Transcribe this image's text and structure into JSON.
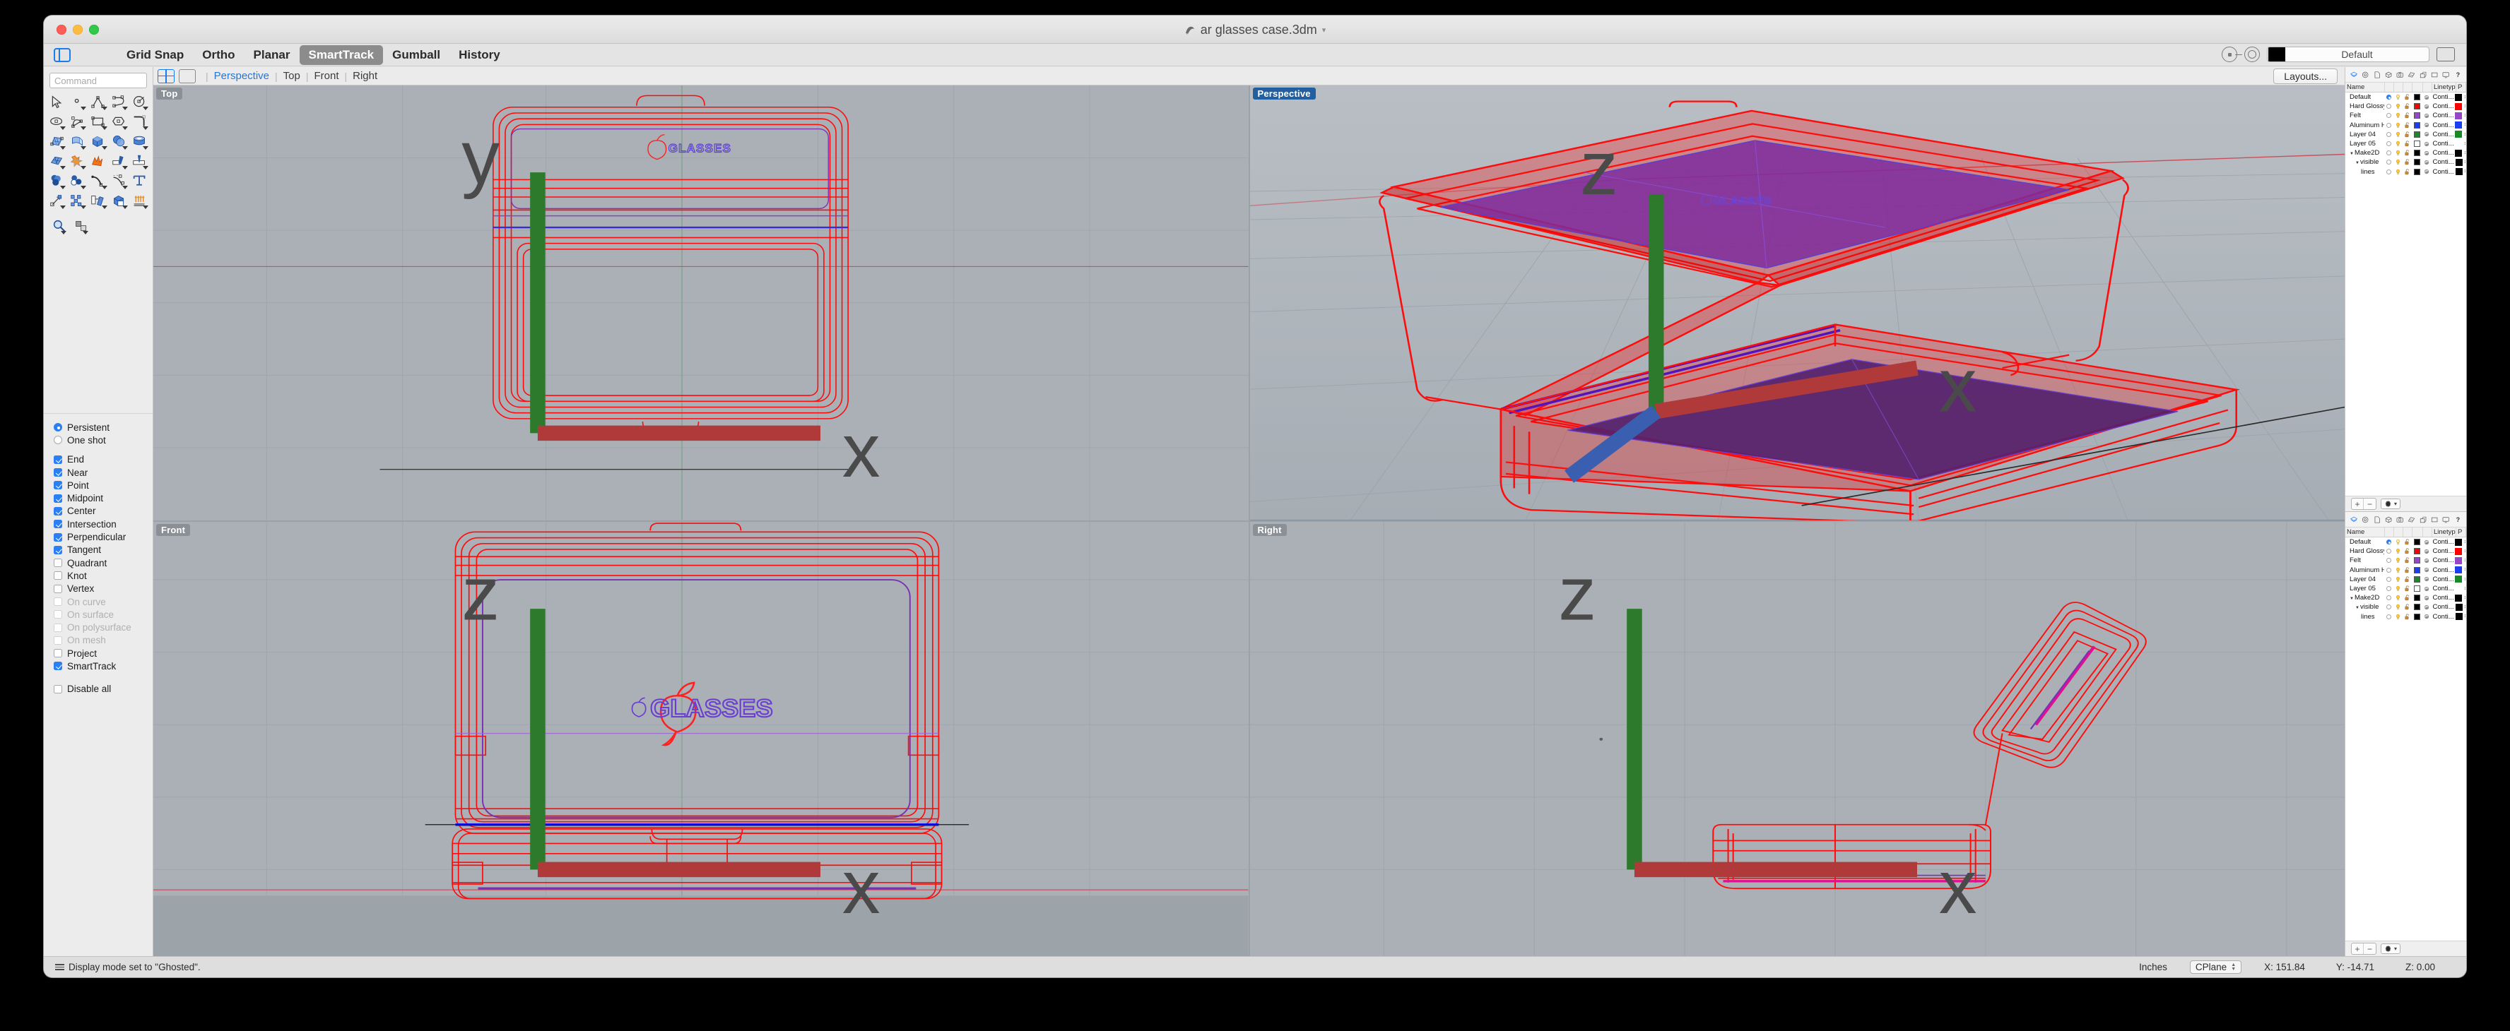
{
  "window": {
    "title": "ar glasses case.3dm",
    "doc_icon": "rhino-doc-icon",
    "title_chevron": "chevron-down-icon"
  },
  "toolbar": {
    "sidebar_toggle_icon": "sidebar-toggle-icon",
    "items": [
      {
        "label": "Grid Snap",
        "active": false
      },
      {
        "label": "Ortho",
        "active": false
      },
      {
        "label": "Planar",
        "active": false
      },
      {
        "label": "SmartTrack",
        "active": true
      },
      {
        "label": "Gumball",
        "active": false
      },
      {
        "label": "History",
        "active": false
      }
    ],
    "layer_color": "#000000",
    "layer_name": "Default",
    "osnap_icon": "osnap-icon",
    "record_icon": "record-history-icon",
    "panel_icon": "right-panel-icon"
  },
  "command": {
    "placeholder": "Command",
    "value": ""
  },
  "tools": [
    {
      "name": "select-arrow-tool",
      "icon": "arrow"
    },
    {
      "name": "point-tool",
      "icon": "point"
    },
    {
      "name": "polyline-tool",
      "icon": "polyline"
    },
    {
      "name": "curve-tool",
      "icon": "curve"
    },
    {
      "name": "circle-tool",
      "icon": "circle"
    },
    {
      "name": "ellipse-tool",
      "icon": "ellipse"
    },
    {
      "name": "arc-tool",
      "icon": "arc"
    },
    {
      "name": "rectangle-tool",
      "icon": "rectangle"
    },
    {
      "name": "polygon-tool",
      "icon": "polygon"
    },
    {
      "name": "fillet-curve-tool",
      "icon": "fillet"
    },
    {
      "name": "surface-from-points-tool",
      "icon": "srf-pts"
    },
    {
      "name": "sweep-surface-tool",
      "icon": "sweep"
    },
    {
      "name": "box-tool",
      "icon": "box"
    },
    {
      "name": "sphere-tool",
      "icon": "sphere"
    },
    {
      "name": "cylinder-tool",
      "icon": "cylinder"
    },
    {
      "name": "mesh-tool",
      "icon": "mesh"
    },
    {
      "name": "boolean-union-tool",
      "icon": "bool-union"
    },
    {
      "name": "explode-tool",
      "icon": "explode"
    },
    {
      "name": "trim-tool",
      "icon": "trim"
    },
    {
      "name": "split-tool",
      "icon": "split"
    },
    {
      "name": "boolean-tool",
      "icon": "bool-spheres"
    },
    {
      "name": "boolean-difference-tool",
      "icon": "bool-diff"
    },
    {
      "name": "offset-curve-tool",
      "icon": "offset-curve"
    },
    {
      "name": "dimension-tool",
      "icon": "dimension"
    },
    {
      "name": "text-tool",
      "icon": "text"
    },
    {
      "name": "scale-tool",
      "icon": "scale"
    },
    {
      "name": "array-tool",
      "icon": "array"
    },
    {
      "name": "copy-tool",
      "icon": "copy"
    },
    {
      "name": "cplane-tool",
      "icon": "cplane"
    },
    {
      "name": "extrude-tool",
      "icon": "extrude"
    }
  ],
  "bottom_tools": [
    {
      "name": "zoom-tool",
      "icon": "zoom"
    },
    {
      "name": "render-tool",
      "icon": "render"
    }
  ],
  "osnap": {
    "modes": [
      {
        "label": "Persistent",
        "type": "radio",
        "checked": true,
        "disabled": false
      },
      {
        "label": "One shot",
        "type": "radio",
        "checked": false,
        "disabled": false
      }
    ],
    "snaps": [
      {
        "label": "End",
        "checked": true,
        "disabled": false
      },
      {
        "label": "Near",
        "checked": true,
        "disabled": false
      },
      {
        "label": "Point",
        "checked": true,
        "disabled": false
      },
      {
        "label": "Midpoint",
        "checked": true,
        "disabled": false
      },
      {
        "label": "Center",
        "checked": true,
        "disabled": false
      },
      {
        "label": "Intersection",
        "checked": true,
        "disabled": false
      },
      {
        "label": "Perpendicular",
        "checked": true,
        "disabled": false
      },
      {
        "label": "Tangent",
        "checked": true,
        "disabled": false
      },
      {
        "label": "Quadrant",
        "checked": false,
        "disabled": false
      },
      {
        "label": "Knot",
        "checked": false,
        "disabled": false
      },
      {
        "label": "Vertex",
        "checked": false,
        "disabled": false
      },
      {
        "label": "On curve",
        "checked": false,
        "disabled": true
      },
      {
        "label": "On surface",
        "checked": false,
        "disabled": true
      },
      {
        "label": "On polysurface",
        "checked": false,
        "disabled": true
      },
      {
        "label": "On mesh",
        "checked": false,
        "disabled": true
      },
      {
        "label": "Project",
        "checked": false,
        "disabled": false
      },
      {
        "label": "SmartTrack",
        "checked": true,
        "disabled": false
      }
    ],
    "disable_all": {
      "label": "Disable all",
      "checked": false
    }
  },
  "viewport_bar": {
    "quad_icon": "four-viewport-icon",
    "single_icon": "single-viewport-icon",
    "tabs": [
      {
        "label": "Perspective",
        "active": true
      },
      {
        "label": "Top",
        "active": false
      },
      {
        "label": "Front",
        "active": false
      },
      {
        "label": "Right",
        "active": false
      }
    ],
    "layouts_label": "Layouts..."
  },
  "viewports": [
    {
      "label": "Top",
      "active": false
    },
    {
      "label": "Perspective",
      "active": true
    },
    {
      "label": "Front",
      "active": false
    },
    {
      "label": "Right",
      "active": false
    }
  ],
  "model": {
    "engraved_text": "GLASSES",
    "logo": "apple-logo",
    "shell_color": "#ff0000",
    "felt_color": "#7a2f9e",
    "hinge_color": "#1414ff"
  },
  "layers_panel": {
    "tab_icons": [
      "layers-icon",
      "properties-icon",
      "notes-icon",
      "object-icon",
      "render-icon",
      "materials-icon",
      "named-cplanes-icon",
      "named-views-icon",
      "display-icon",
      "help-icon"
    ],
    "columns": [
      "Name",
      "",
      "",
      "",
      "",
      "",
      "Linetype",
      "P"
    ],
    "rows": [
      {
        "name": "Default",
        "indent": 0,
        "current": true,
        "color": "#000000",
        "linetype": "Conti...",
        "print_color": "#000000",
        "expander": ""
      },
      {
        "name": "Hard Glossy P...",
        "indent": 0,
        "current": false,
        "color": "#ff0000",
        "linetype": "Conti...",
        "print_color": "#ff0000",
        "expander": ""
      },
      {
        "name": "Felt",
        "indent": 0,
        "current": false,
        "color": "#9448c8",
        "linetype": "Conti...",
        "print_color": "#9448c8",
        "expander": ""
      },
      {
        "name": "Aluminum Hin...",
        "indent": 0,
        "current": false,
        "color": "#1a3ef0",
        "linetype": "Conti...",
        "print_color": "#1a3ef0",
        "expander": ""
      },
      {
        "name": "Layer 04",
        "indent": 0,
        "current": false,
        "color": "#1a8a28",
        "linetype": "Conti...",
        "print_color": "#1a8a28",
        "expander": ""
      },
      {
        "name": "Layer 05",
        "indent": 0,
        "current": false,
        "color": "#ffffff",
        "linetype": "Conti...",
        "print_color": "#ffffff",
        "expander": ""
      },
      {
        "name": "Make2D",
        "indent": 0,
        "current": false,
        "color": "#000000",
        "linetype": "Conti...",
        "print_color": "#000000",
        "expander": "expanded"
      },
      {
        "name": "visible",
        "indent": 1,
        "current": false,
        "color": "#000000",
        "linetype": "Conti...",
        "print_color": "#000000",
        "expander": "expanded"
      },
      {
        "name": "lines",
        "indent": 2,
        "current": false,
        "color": "#000000",
        "linetype": "Conti...",
        "print_color": "#000000",
        "expander": ""
      }
    ],
    "footer": {
      "add_label": "+",
      "remove_label": "−",
      "gear_icon": "gear-icon",
      "chevron_icon": "chevron-down-icon"
    }
  },
  "status": {
    "message": "Display mode set to \"Ghosted\".",
    "menu_icon": "status-menu-icon",
    "units": "Inches",
    "cplane": "CPlane",
    "x": "X: 151.84",
    "y": "Y: -14.71",
    "z": "Z: 0.00"
  }
}
